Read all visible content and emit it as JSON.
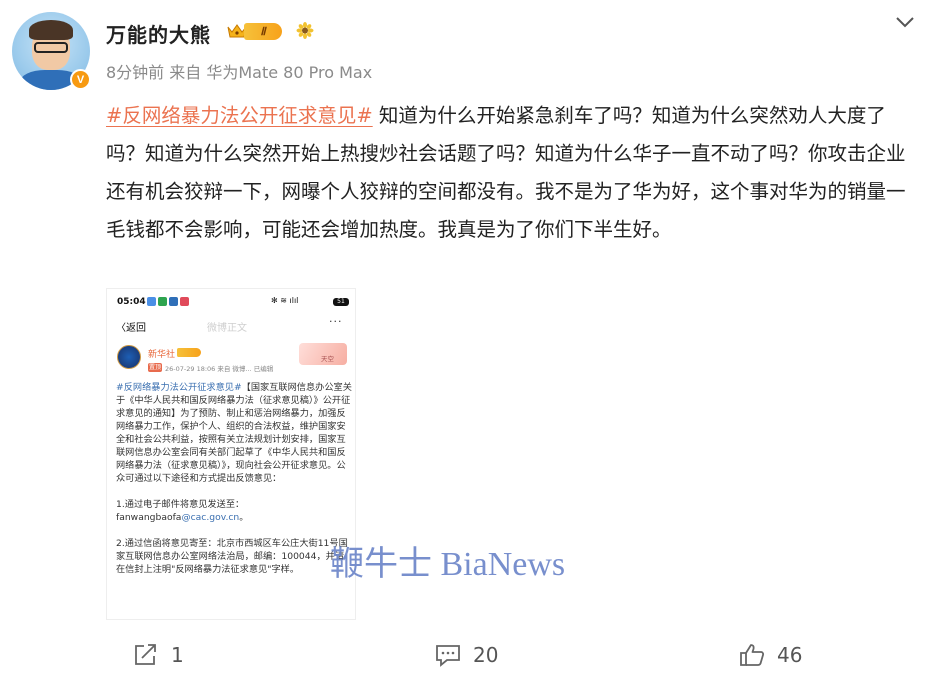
{
  "post": {
    "username": "万能的大熊",
    "level_badge": "Ⅱ",
    "verified_badge": "V",
    "meta": "8分钟前  来自 华为Mate 80 Pro Max",
    "hashtag": "#反网络暴力法公开征求意见#",
    "body": " 知道为什么开始紧急刹车了吗？知道为什么突然劝人大度了吗？知道为什么突然开始上热搜炒社会话题了吗？知道为什么华子一直不动了吗？你攻击企业还有机会狡辩一下，网曝个人狡辩的空间都没有。我不是为了华为好，这个事对华为的销量一毛钱都不会影响，可能还会增加热度。我真是为了你们下半生好。",
    "icons": {
      "crown": "crown-icon",
      "medal": "sunflower-medal-icon",
      "chevron": "chevron-down-icon"
    }
  },
  "embedded_screenshot": {
    "time": "05:04",
    "signal_text": "✻ ≋ ılıl",
    "battery": "51",
    "back_label": "〈返回",
    "nav_title": "微博正文",
    "more": "···",
    "account_name": "新华社",
    "top_label": "置顶",
    "post_meta": "26-07-29 18:06  来自 微博...      已编辑",
    "deco_label": "天空",
    "hashtag": "#反网络暴力法公开征求意见#",
    "paragraph_1": "【国家互联网信息办公室关于《中华人民共和国反网络暴力法（征求意见稿）》公开征求意见的通知】为了预防、制止和惩治网络暴力，加强反网络暴力工作，保护个人、组织的合法权益，维护国家安全和社会公共利益，按照有关立法规划计划安排，国家互联网信息办公室会同有关部门起草了《中华人民共和国反网络暴力法（征求意见稿）》，现向社会公开征求意见。公众可通过以下途径和方式提出反馈意见：",
    "item_1_label": "1.通过电子邮件将意见发送至：",
    "item_1_email_prefix": "fanwangbaofa",
    "item_1_email": "@cac.gov.cn",
    "item_1_suffix": "。",
    "item_2": "2.通过信函将意见寄至：北京市西城区车公庄大街11号国家互联网信息办公室网络法治局，邮编：100044，并请在信封上注明\"反网络暴力法征求意见\"字样。"
  },
  "watermark": "鞭牛士 BiaNews",
  "actions": {
    "repost_count": "1",
    "comment_count": "20",
    "like_count": "46",
    "icons": {
      "repost": "repost-icon",
      "comment": "comment-icon",
      "like": "thumbs-up-icon"
    }
  }
}
